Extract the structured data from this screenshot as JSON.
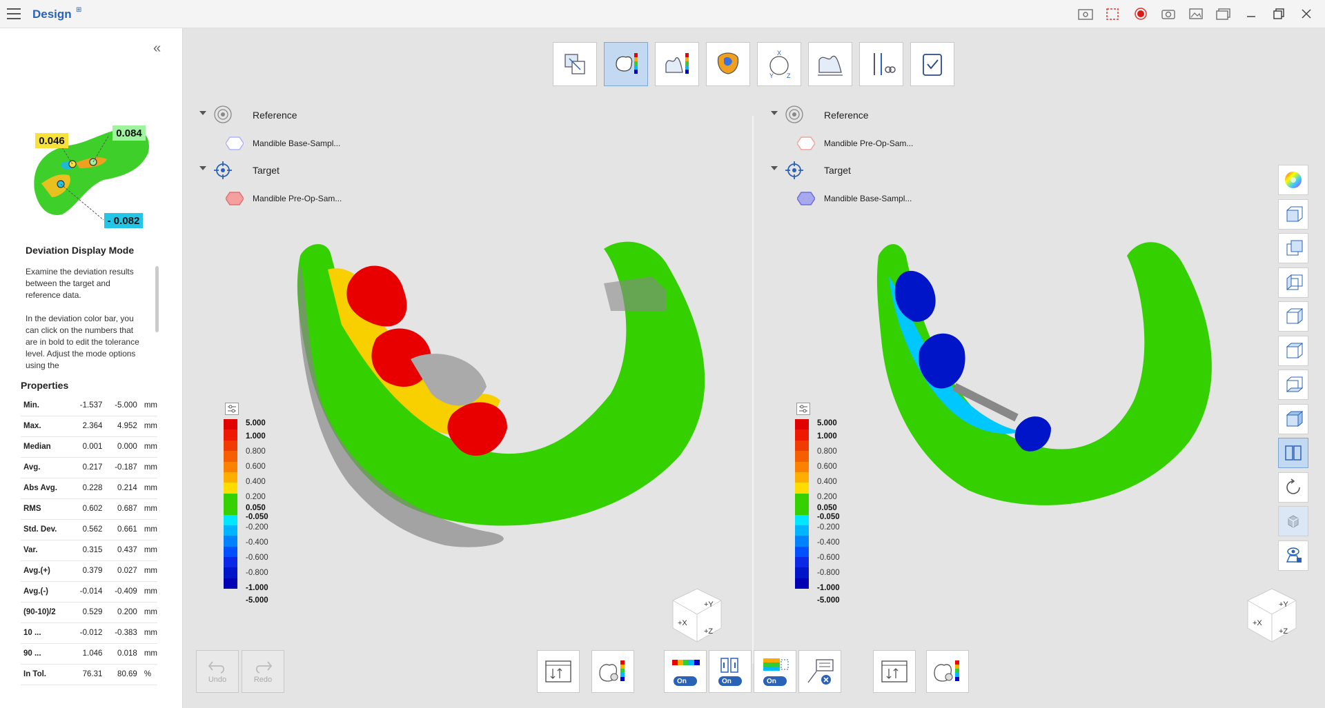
{
  "app": {
    "title": "Design"
  },
  "sidebar": {
    "thumbnail_labels": {
      "top_left": "0.046",
      "top_right": "0.084",
      "bottom": "- 0.082"
    },
    "mode_title": "Deviation Display Mode",
    "mode_desc_1": "Examine the deviation results between the target and reference data.",
    "mode_desc_2": "In the deviation color bar, you can click on the numbers that are in bold to edit the tolerance level. Adjust the mode options using the",
    "properties_title": "Properties",
    "properties": [
      {
        "name": "Min.",
        "v1": "-1.537",
        "v2": "-5.000",
        "unit": "mm"
      },
      {
        "name": "Max.",
        "v1": "2.364",
        "v2": "4.952",
        "unit": "mm"
      },
      {
        "name": "Median",
        "v1": "0.001",
        "v2": "0.000",
        "unit": "mm"
      },
      {
        "name": "Avg.",
        "v1": "0.217",
        "v2": "-0.187",
        "unit": "mm"
      },
      {
        "name": "Abs Avg.",
        "v1": "0.228",
        "v2": "0.214",
        "unit": "mm"
      },
      {
        "name": "RMS",
        "v1": "0.602",
        "v2": "0.687",
        "unit": "mm"
      },
      {
        "name": "Std. Dev.",
        "v1": "0.562",
        "v2": "0.661",
        "unit": "mm"
      },
      {
        "name": "Var.",
        "v1": "0.315",
        "v2": "0.437",
        "unit": "mm"
      },
      {
        "name": "Avg.(+)",
        "v1": "0.379",
        "v2": "0.027",
        "unit": "mm"
      },
      {
        "name": "Avg.(-)",
        "v1": "-0.014",
        "v2": "-0.409",
        "unit": "mm"
      },
      {
        "name": "(90-10)/2",
        "v1": "0.529",
        "v2": "0.200",
        "unit": "mm"
      },
      {
        "name": "10 ...",
        "v1": "-0.012",
        "v2": "-0.383",
        "unit": "mm"
      },
      {
        "name": "90 ...",
        "v1": "1.046",
        "v2": "0.018",
        "unit": "mm"
      },
      {
        "name": "In Tol.",
        "v1": "76.31",
        "v2": "80.69",
        "unit": "%"
      }
    ]
  },
  "left_view": {
    "reference_label": "Reference",
    "reference_item": "Mandible Base-Sampl...",
    "target_label": "Target",
    "target_item": "Mandible Pre-Op-Sam..."
  },
  "right_view": {
    "reference_label": "Reference",
    "reference_item": "Mandible Pre-Op-Sam...",
    "target_label": "Target",
    "target_item": "Mandible Base-Sampl..."
  },
  "color_scale": {
    "labels": [
      "5.000",
      "1.000",
      "0.800",
      "0.600",
      "0.400",
      "0.200",
      "0.050",
      "-0.050",
      "-0.200",
      "-0.400",
      "-0.600",
      "-0.800",
      "-1.000",
      "-5.000"
    ],
    "bold": [
      true,
      true,
      false,
      false,
      false,
      false,
      true,
      true,
      false,
      false,
      false,
      false,
      true,
      true
    ],
    "colors": [
      "#e00000",
      "#ee1a00",
      "#f03c00",
      "#f55f00",
      "#fa8200",
      "#ffae00",
      "#ffdc00",
      "#34d000",
      "#34d000",
      "#00e6ff",
      "#00b4ff",
      "#0082ff",
      "#0050ff",
      "#0a28e6",
      "#0014c8",
      "#0000b4"
    ]
  },
  "navcube": {
    "y": "+Y",
    "x": "+X",
    "z": "+Z"
  },
  "bottom": {
    "undo": "Undo",
    "redo": "Redo",
    "on": "On"
  },
  "colors": {
    "accent": "#2a62b8",
    "red": "#e00000",
    "green": "#34d000",
    "blue": "#0014c8"
  }
}
